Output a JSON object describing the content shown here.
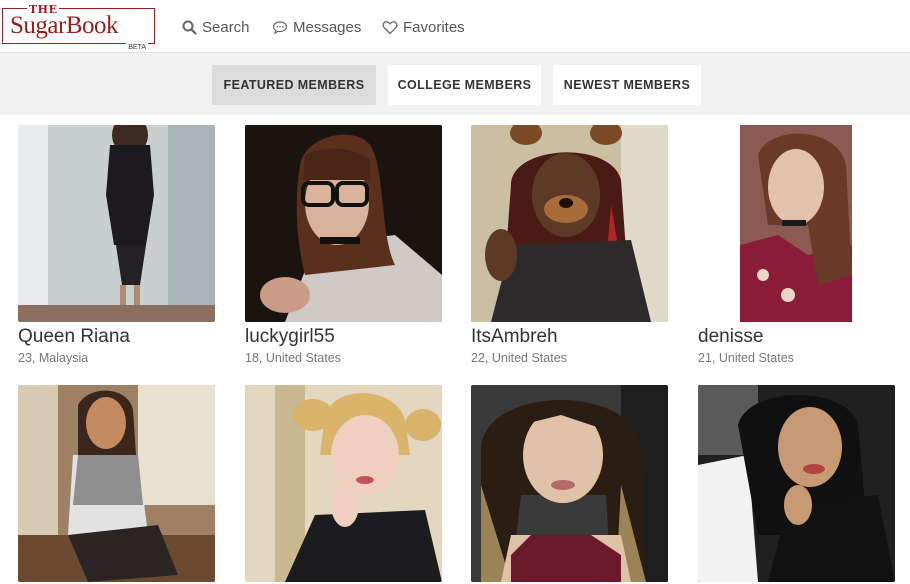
{
  "logo": {
    "the": "THE",
    "word": "SugarBook",
    "beta": "BETA"
  },
  "nav": {
    "search": "Search",
    "messages": "Messages",
    "favorites": "Favorites"
  },
  "tabs": [
    "FEATURED MEMBERS",
    "COLLEGE MEMBERS",
    "NEWEST MEMBERS"
  ],
  "members": [
    {
      "name": "Queen Riana",
      "meta": "23, Malaysia"
    },
    {
      "name": "luckygirl55",
      "meta": "18, United States"
    },
    {
      "name": "ItsAmbreh",
      "meta": "22, United States"
    },
    {
      "name": "denisse",
      "meta": "21, United States"
    },
    {
      "name": "",
      "meta": ""
    },
    {
      "name": "",
      "meta": ""
    },
    {
      "name": "",
      "meta": ""
    },
    {
      "name": "",
      "meta": ""
    }
  ],
  "colors": {
    "brand": "#9b1c1c",
    "active_tab": "#dcdcdc",
    "subbar": "#f2f2f2"
  }
}
